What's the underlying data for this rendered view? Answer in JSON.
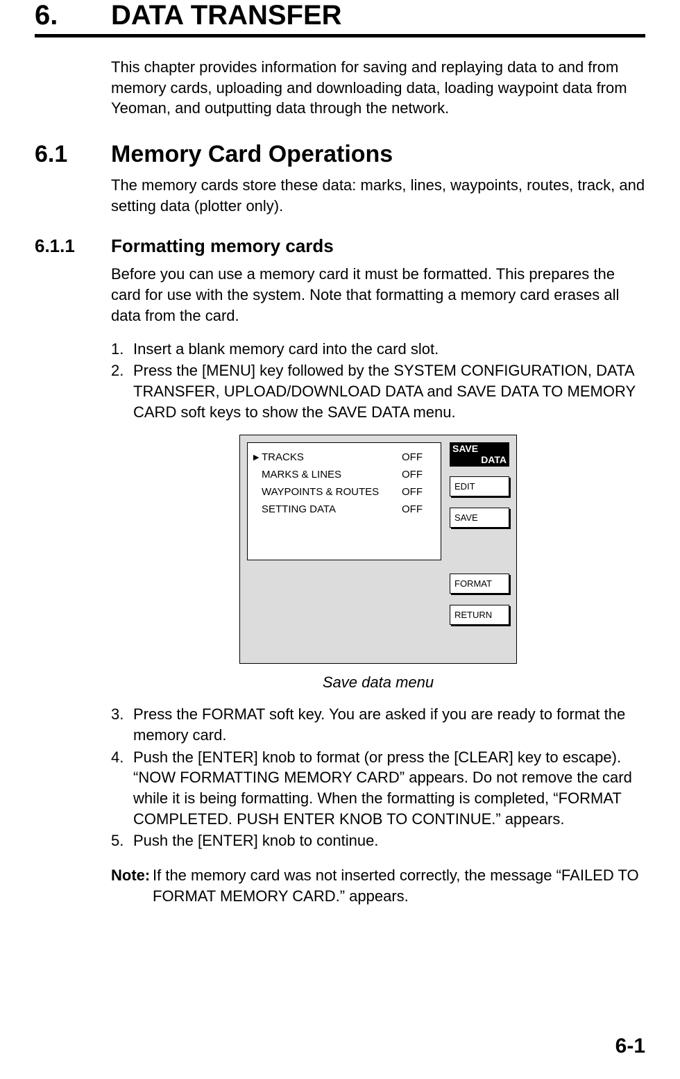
{
  "chapter": {
    "num": "6.",
    "title": "DATA TRANSFER"
  },
  "intro": "This chapter provides information for saving and replaying data to and from memory cards, uploading and downloading data, loading waypoint data from Yeoman, and outputting data through the network.",
  "sec": {
    "num": "6.1",
    "title": "Memory Card Operations",
    "text": "The memory cards store these data: marks, lines, waypoints, routes, track, and setting data (plotter only)."
  },
  "sub": {
    "num": "6.1.1",
    "title": "Formatting memory cards",
    "text": "Before you can use a memory card it must be formatted. This prepares the card for use with the system. Note that formatting a memory card erases all data from the card."
  },
  "steps1": [
    {
      "n": "1.",
      "t": "Insert a blank memory card into the card slot."
    },
    {
      "n": "2.",
      "t": "Press the [MENU] key followed by the SYSTEM CONFIGURATION, DATA TRANSFER, UPLOAD/DOWNLOAD DATA and SAVE DATA TO MEMORY CARD soft keys to show the SAVE DATA menu."
    }
  ],
  "menu": {
    "title_l1": "SAVE",
    "title_l2": "DATA",
    "rows": [
      {
        "cursor": "▶",
        "label": "TRACKS",
        "val": "OFF"
      },
      {
        "cursor": "",
        "label": "MARKS & LINES",
        "val": "OFF"
      },
      {
        "cursor": "",
        "label": "WAYPOINTS & ROUTES",
        "val": "OFF"
      },
      {
        "cursor": "",
        "label": "SETTING DATA",
        "val": "OFF"
      }
    ],
    "sk": {
      "edit": "EDIT",
      "save": "SAVE",
      "format": "FORMAT",
      "return": "RETURN"
    }
  },
  "caption": "Save data menu",
  "steps2": [
    {
      "n": "3.",
      "t": "Press the FORMAT soft key. You are asked if you are ready to format the memory card."
    },
    {
      "n": "4.",
      "t": "Push the [ENTER] knob to format (or press the [CLEAR] key to escape). “NOW FORMATTING MEMORY CARD” appears. Do not remove the card while it is being formatting. When the formatting is completed, “FORMAT COMPLETED. PUSH ENTER KNOB TO CONTINUE.” appears."
    },
    {
      "n": "5.",
      "t": "Push the [ENTER] knob to continue."
    }
  ],
  "note": {
    "label": "Note:",
    "text": "If the memory card was not inserted correctly, the message “FAILED TO FORMAT MEMORY CARD.” appears."
  },
  "page": "6-1"
}
